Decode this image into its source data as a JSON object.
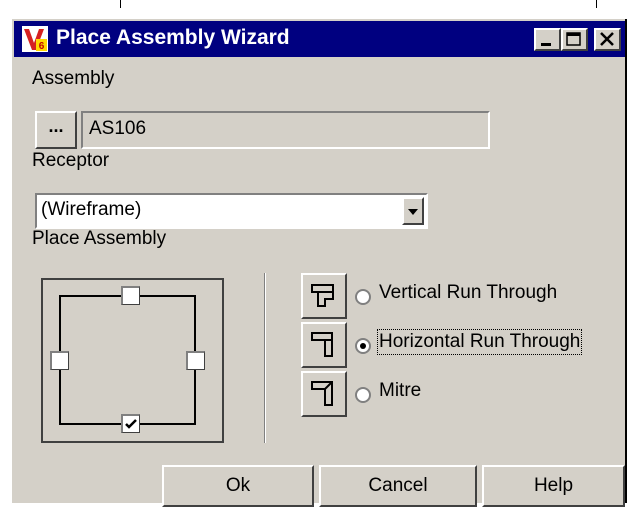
{
  "window": {
    "title": "Place Assembly Wizard",
    "icon": "v6-app-icon",
    "controls": [
      "minimize",
      "maximize",
      "close"
    ]
  },
  "assembly": {
    "label": "Assembly",
    "browse_label": "...",
    "value": "AS106"
  },
  "receptor": {
    "label": "Receptor",
    "selected": "(Wireframe)"
  },
  "place_assembly": {
    "label": "Place Assembly",
    "sides": {
      "top": false,
      "left": false,
      "right": false,
      "bottom": true
    },
    "options": [
      {
        "label": "Vertical Run Through",
        "selected": false
      },
      {
        "label": "Horizontal Run Through",
        "selected": true
      },
      {
        "label": "Mitre",
        "selected": false
      }
    ]
  },
  "buttons": {
    "ok": "Ok",
    "cancel": "Cancel",
    "help": "Help"
  },
  "colors": {
    "titlebar": "#000080",
    "face": "#d4d0c8"
  }
}
